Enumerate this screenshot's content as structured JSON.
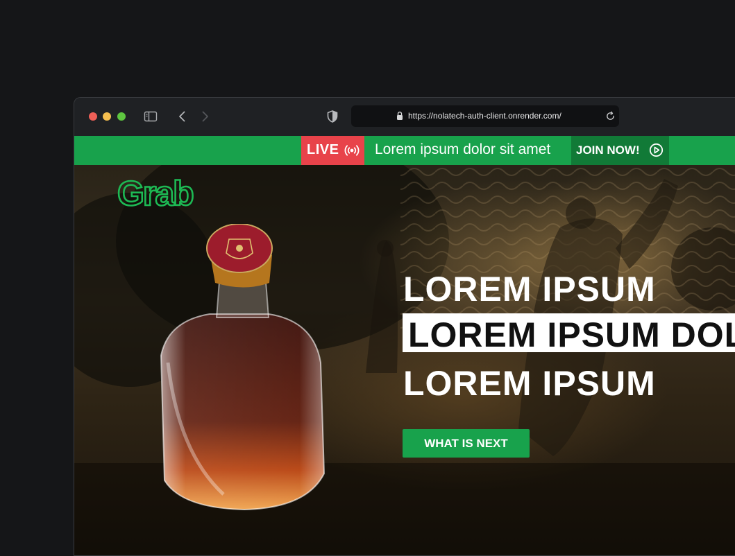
{
  "browser": {
    "url": "https://nolatech-auth-client.onrender.com/"
  },
  "banner": {
    "live_label": "LIVE",
    "message": "Lorem ipsum dolor sit amet",
    "join_label": "JOIN NOW!"
  },
  "hero": {
    "logo_text": "Grab",
    "headline_line1": "LOREM IPSUM",
    "headline_line2": "LOREM IPSUM DOLOR",
    "headline_line3": "LOREM IPSUM",
    "cta_label": "WHAT IS NEXT"
  },
  "colors": {
    "brand_green": "#18a24c",
    "live_red": "#e8434a",
    "join_dark_green": "#117a37"
  }
}
